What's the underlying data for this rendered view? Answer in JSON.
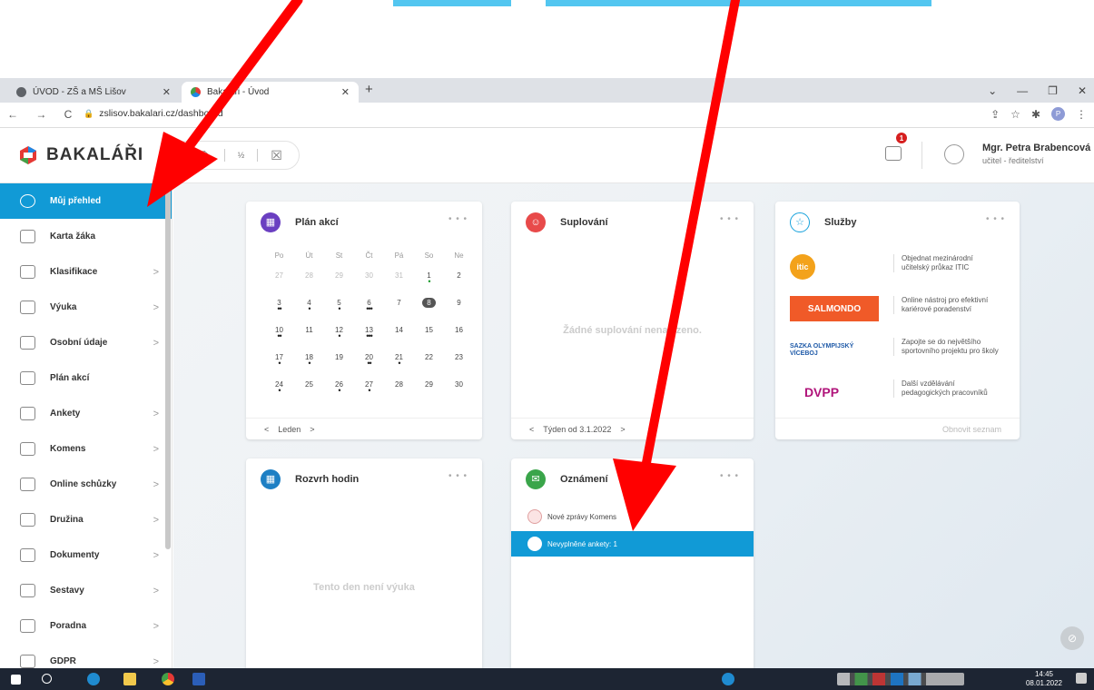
{
  "browser": {
    "tabs": [
      {
        "label": "ÚVOD - ZŠ a MŠ Lišov"
      },
      {
        "label": "Bakaláři - Úvod"
      }
    ],
    "url": "zslisov.bakalari.cz/dashboard"
  },
  "app": {
    "brand": "BAKALÁŘI",
    "message_badge": "1",
    "user_name": "Mgr. Petra Brabencová",
    "user_role": "učitel - ředitelství"
  },
  "sidebar": {
    "items": [
      {
        "label": "Můj přehled",
        "active": true,
        "icon": "dashboard-icon"
      },
      {
        "label": "Karta žáka",
        "icon": "student-card-icon"
      },
      {
        "label": "Klasifikace",
        "icon": "grade-icon"
      },
      {
        "label": "Výuka",
        "icon": "teaching-icon"
      },
      {
        "label": "Osobní údaje",
        "icon": "personal-data-icon"
      },
      {
        "label": "Plán akcí",
        "icon": "event-plan-icon"
      },
      {
        "label": "Ankety",
        "icon": "survey-icon"
      },
      {
        "label": "Komens",
        "icon": "message-icon"
      },
      {
        "label": "Online schůzky",
        "icon": "meeting-icon"
      },
      {
        "label": "Družina",
        "icon": "group-icon"
      },
      {
        "label": "Dokumenty",
        "icon": "document-icon"
      },
      {
        "label": "Sestavy",
        "icon": "report-icon"
      },
      {
        "label": "Poradna",
        "icon": "counseling-icon"
      },
      {
        "label": "GDPR",
        "icon": "gdpr-icon"
      }
    ]
  },
  "plan_akci": {
    "title": "Plán akcí",
    "weekdays": [
      "Po",
      "Út",
      "St",
      "Čt",
      "Pá",
      "So",
      "Ne"
    ],
    "weeks": [
      [
        "27",
        "28",
        "29",
        "30",
        "31",
        "1",
        "2"
      ],
      [
        "3",
        "4",
        "5",
        "6",
        "7",
        "8",
        "9"
      ],
      [
        "10",
        "11",
        "12",
        "13",
        "14",
        "15",
        "16"
      ],
      [
        "17",
        "18",
        "19",
        "20",
        "21",
        "22",
        "23"
      ],
      [
        "24",
        "25",
        "26",
        "27",
        "28",
        "29",
        "30"
      ]
    ],
    "month": "Leden"
  },
  "suplovani": {
    "title": "Suplování",
    "empty": "Žádné suplování nenalezeno.",
    "week": "Týden od 3.1.2022"
  },
  "sluzby": {
    "title": "Služby",
    "items": [
      {
        "logo": "itic",
        "text": "Objednat mezinárodní učitelský průkaz ITIC"
      },
      {
        "logo": "SALMONDO",
        "text": "Online nástroj pro efektivní kariérové poradenství"
      },
      {
        "logo": "SAZKA OLYMPIJSKÝ VÍCEBOJ",
        "text": "Zapojte se do největšího sportovního projektu pro školy"
      },
      {
        "logo": "DVPP",
        "text": "Další vzdělávání pedagogických pracovníků"
      }
    ],
    "refresh": "Obnovit seznam"
  },
  "rozvrh": {
    "title": "Rozvrh hodin",
    "empty": "Tento den není výuka"
  },
  "oznameni": {
    "title": "Oznámení",
    "items": [
      {
        "text": "Nové zprávy Komens"
      },
      {
        "text": "Nevyplněné ankety: 1",
        "selected": true
      }
    ]
  },
  "taskbar": {
    "time": "14:45",
    "date": "08.01.2022"
  },
  "colors": {
    "accent": "#119ad6",
    "annotation_arrow": "#ff0000"
  }
}
